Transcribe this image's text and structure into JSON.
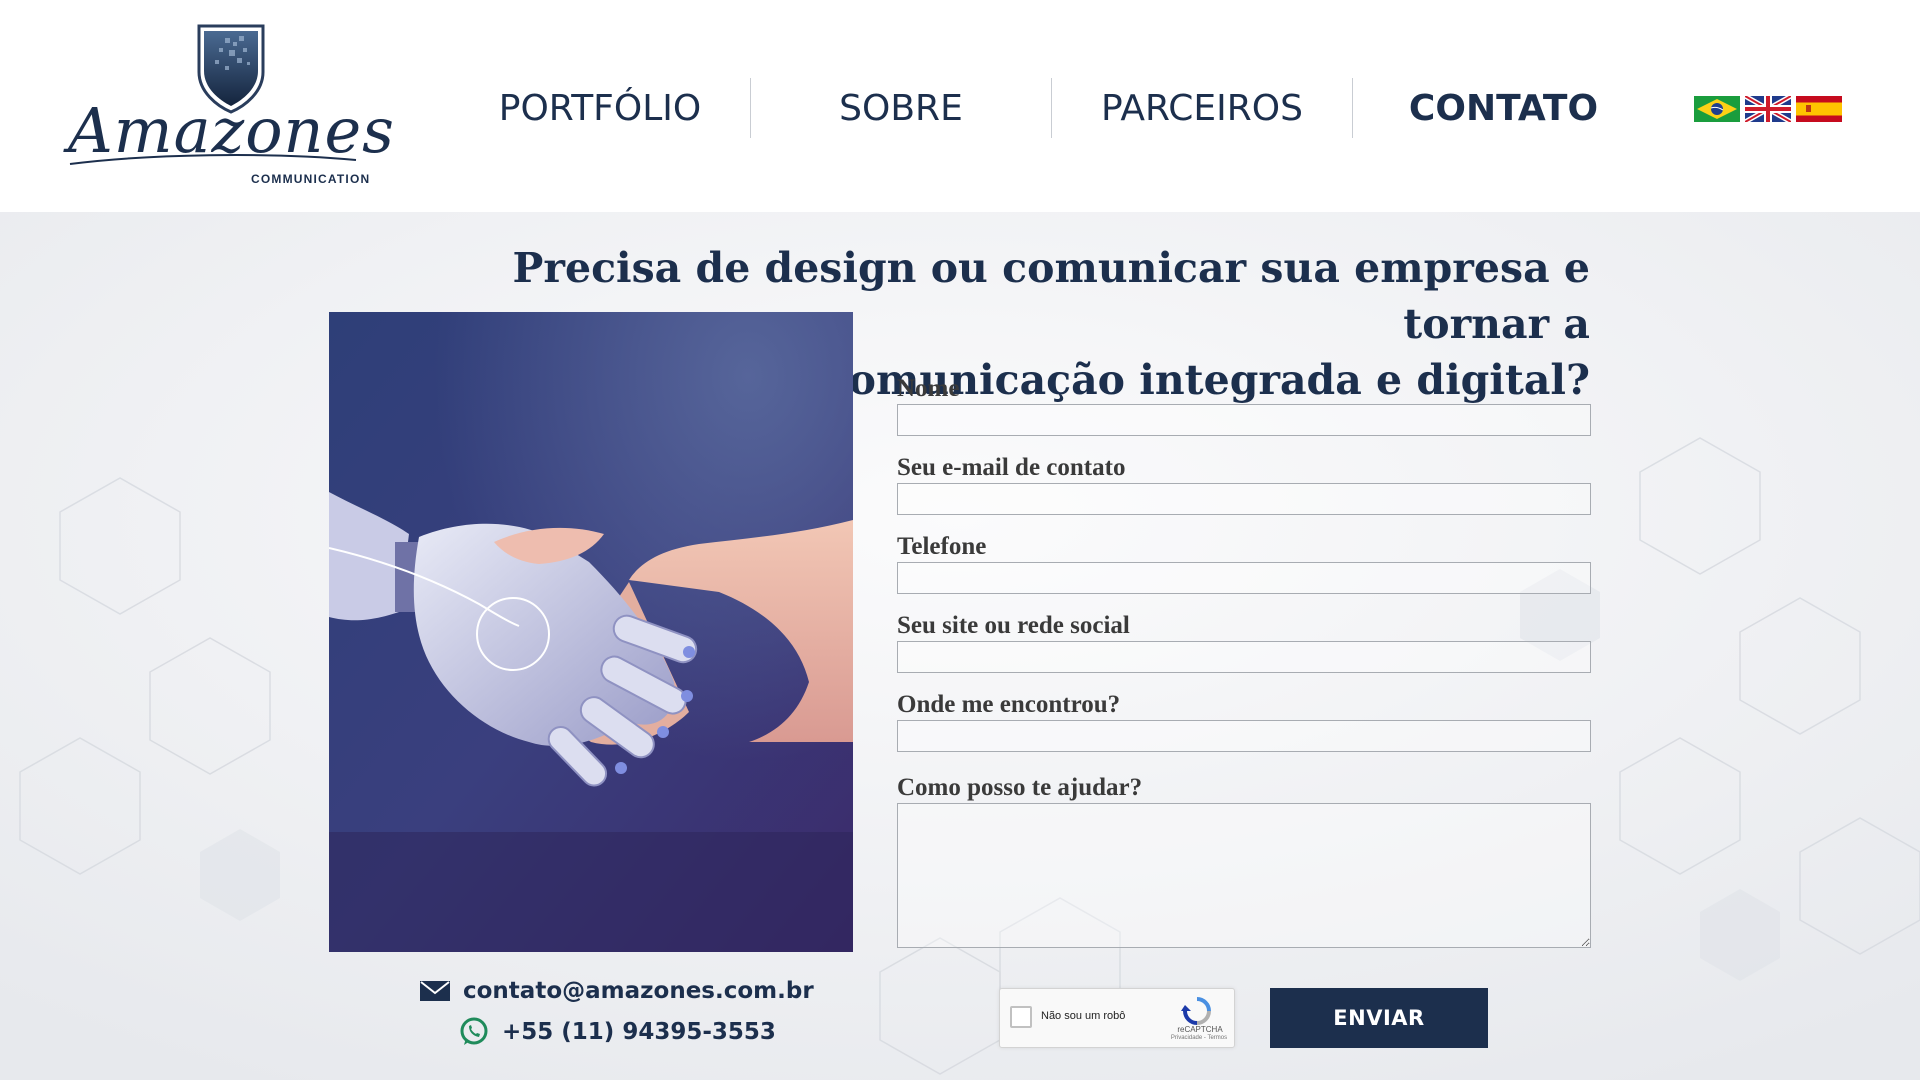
{
  "brand": {
    "name": "Amazones",
    "sub": "COMMUNICATION"
  },
  "nav": {
    "items": [
      {
        "label": "PORTFÓLIO"
      },
      {
        "label": "SOBRE"
      },
      {
        "label": "PARCEIROS"
      },
      {
        "label": "CONTATO",
        "active": true
      }
    ]
  },
  "languages": [
    {
      "icon": "brazil-flag-icon"
    },
    {
      "icon": "uk-flag-icon"
    },
    {
      "icon": "spain-flag-icon"
    }
  ],
  "headline": {
    "line1": "Precisa de design ou comunicar sua empresa e tornar a",
    "line2": "comunicação integrada e digital?"
  },
  "hero": {
    "icon": "robot-human-handshake-image"
  },
  "form": {
    "fields": [
      {
        "label": "Nome",
        "value": ""
      },
      {
        "label": "Seu e-mail de contato",
        "value": ""
      },
      {
        "label": "Telefone",
        "value": ""
      },
      {
        "label": "Seu site ou rede social",
        "value": ""
      },
      {
        "label": "Onde me encontrou?",
        "value": ""
      },
      {
        "label": "Como posso te ajudar?",
        "value": ""
      }
    ],
    "captcha": {
      "label": "Não sou um robô",
      "brand": "reCAPTCHA",
      "links": "Privacidade - Termos"
    },
    "submit_label": "ENVIAR"
  },
  "contact": {
    "email": "contato@amazones.com.br",
    "phone": "+55 (11) 94395-3553"
  },
  "colors": {
    "brand": "#1c2f4d",
    "background": "#f4f5f7"
  }
}
